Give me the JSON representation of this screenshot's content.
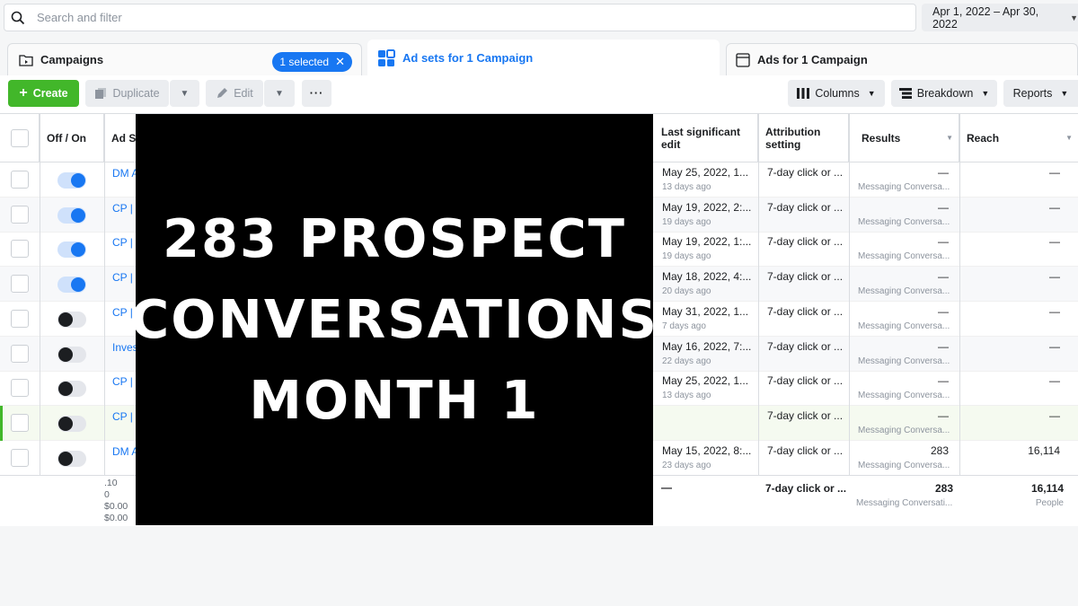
{
  "search": {
    "placeholder": "Search and filter"
  },
  "date_range": "Apr 1, 2022 – Apr 30, 2022",
  "tabs": {
    "campaigns": "Campaigns",
    "selected_pill": "1 selected",
    "ad_sets": "Ad sets for 1 Campaign",
    "ads": "Ads for 1 Campaign"
  },
  "toolbar": {
    "create": "Create",
    "duplicate": "Duplicate",
    "edit": "Edit",
    "more": "···",
    "columns": "Columns",
    "breakdown": "Breakdown",
    "reports": "Reports"
  },
  "table": {
    "headers": {
      "off_on": "Off / On",
      "ad_set": "Ad S",
      "last_edit": "Last significant edit",
      "attribution": "Attribution setting",
      "results": "Results",
      "reach": "Reach"
    },
    "rows": [
      {
        "on": true,
        "name": "DM A",
        "edit": "May 25, 2022, 1...",
        "ago": "13 days ago",
        "attr": "7-day click or ...",
        "result": "—",
        "result_sub": "Messaging Conversa...",
        "reach": "—"
      },
      {
        "on": true,
        "name": "CP |",
        "edit": "May 19, 2022, 2:...",
        "ago": "19 days ago",
        "attr": "7-day click or ...",
        "result": "—",
        "result_sub": "Messaging Conversa...",
        "reach": "—"
      },
      {
        "on": true,
        "name": "CP |",
        "edit": "May 19, 2022, 1:...",
        "ago": "19 days ago",
        "attr": "7-day click or ...",
        "result": "—",
        "result_sub": "Messaging Conversa...",
        "reach": "—"
      },
      {
        "on": true,
        "name": "CP |",
        "edit": "May 18, 2022, 4:...",
        "ago": "20 days ago",
        "attr": "7-day click or ...",
        "result": "—",
        "result_sub": "Messaging Conversa...",
        "reach": "—"
      },
      {
        "on": false,
        "name": "CP |",
        "edit": "May 31, 2022, 1...",
        "ago": "7 days ago",
        "attr": "7-day click or ...",
        "result": "—",
        "result_sub": "Messaging Conversa...",
        "reach": "—"
      },
      {
        "on": false,
        "name": "Inves",
        "edit": "May 16, 2022, 7:...",
        "ago": "22 days ago",
        "attr": "7-day click or ...",
        "result": "—",
        "result_sub": "Messaging Conversa...",
        "reach": "—"
      },
      {
        "on": false,
        "name": "CP |",
        "edit": "May 25, 2022, 1...",
        "ago": "13 days ago",
        "attr": "7-day click or ...",
        "result": "—",
        "result_sub": "Messaging Conversa...",
        "reach": "—"
      },
      {
        "on": false,
        "name": "CP |",
        "edit": "",
        "ago": "",
        "attr": "7-day click or ...",
        "result": "—",
        "result_sub": "Messaging Conversa...",
        "reach": "—"
      },
      {
        "on": false,
        "name": "DM A",
        "edit": "May 15, 2022, 8:...",
        "ago": "23 days ago",
        "attr": "7-day click or ...",
        "result": "283",
        "result_sub": "Messaging Conversa...",
        "reach": "16,114"
      }
    ],
    "footer": {
      "left_values": [
        ".10",
        "0",
        "$0.00",
        "$0.00"
      ],
      "last_edit": "—",
      "attribution": "7-day click or ...",
      "results": "283",
      "results_sub": "Messaging Conversati...",
      "reach": "16,114",
      "reach_sub": "People"
    }
  },
  "overlay": {
    "lines": [
      "283 PROSPECT",
      "CONVERSATIONS",
      "MONTH 1"
    ]
  },
  "colors": {
    "accent": "#1877f2",
    "create_green": "#42b72a",
    "overlay_bg": "#000000"
  }
}
